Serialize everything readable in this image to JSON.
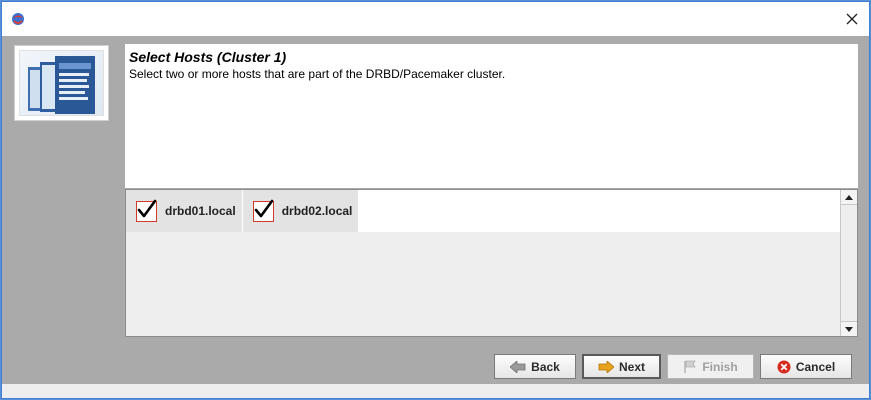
{
  "window": {
    "close_symbol": "✕"
  },
  "header": {
    "title": "Select Hosts (Cluster 1)",
    "subtitle": "Select two or more hosts that are part of the DRBD/Pacemaker cluster."
  },
  "hosts": [
    {
      "name": "drbd01.local",
      "checked": true
    },
    {
      "name": "drbd02.local",
      "checked": true
    }
  ],
  "buttons": {
    "back": "Back",
    "next": "Next",
    "finish": "Finish",
    "cancel": "Cancel"
  },
  "icons": {
    "app": "app-globe-icon",
    "close": "close-icon",
    "logo": "product-box-logo",
    "back": "arrow-left-icon",
    "next": "arrow-right-icon",
    "finish": "finish-flag-icon",
    "cancel": "cancel-icon"
  },
  "colors": {
    "window_border": "#3c7fd4",
    "content_bg": "#aaaaaa",
    "checkbox_border": "#d23b2a",
    "next_arrow": "#e9a21b",
    "cancel_red": "#d72c1f"
  }
}
